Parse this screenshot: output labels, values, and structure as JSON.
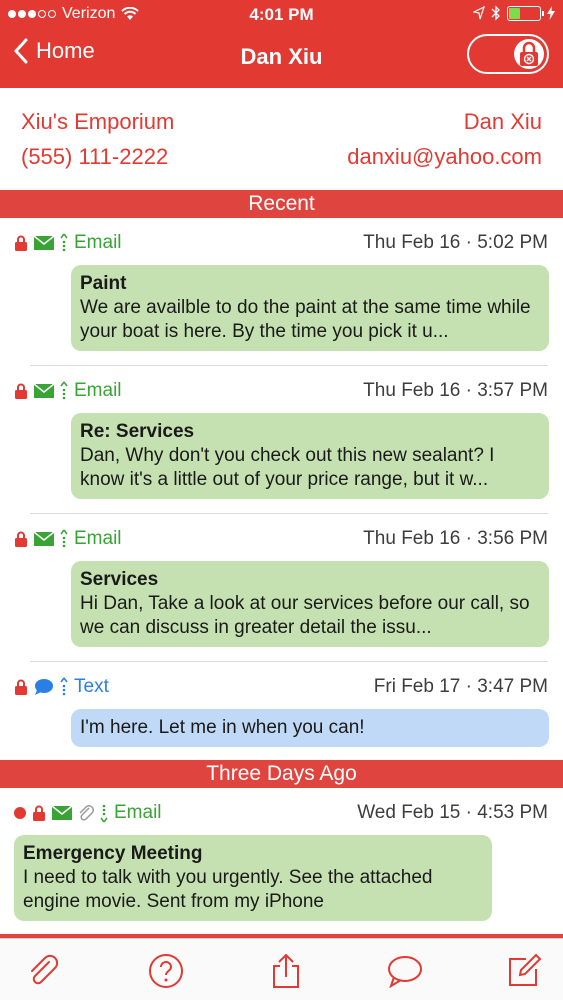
{
  "status": {
    "carrier": "Verizon",
    "time": "4:01 PM"
  },
  "nav": {
    "back_label": "Home",
    "title": "Dan Xiu"
  },
  "contact": {
    "company": "Xiu's Emporium",
    "phone": "(555) 111-2222",
    "name": "Dan Xiu",
    "email": "danxiu@yahoo.com"
  },
  "sections": {
    "recent": "Recent",
    "three_days": "Three Days Ago"
  },
  "messages": [
    {
      "type": "Email",
      "date": "Thu Feb 16 · 5:02 PM",
      "subject": "Paint",
      "body": "We are availble to do the paint at the same time while your boat is here. By the time you pick it u..."
    },
    {
      "type": "Email",
      "date": "Thu Feb 16 · 3:57 PM",
      "subject": "Re: Services",
      "body": "Dan, Why don't you check out this new sealant? I know it's a little out of your price range, but it w..."
    },
    {
      "type": "Email",
      "date": "Thu Feb 16 · 3:56 PM",
      "subject": "Services",
      "body": "Hi Dan, Take a look at our services before our call, so we can discuss in greater detail the issu..."
    },
    {
      "type": "Text",
      "date": "Fri Feb 17 · 3:47 PM",
      "body": "I'm here. Let me in when you can!"
    },
    {
      "type": "Email",
      "date": "Wed Feb 15 · 4:53 PM",
      "subject": "Emergency Meeting",
      "body": "I need to talk with you urgently. See the attached engine movie.  Sent from my iPhone"
    }
  ],
  "colors": {
    "brand_red": "#e23a33",
    "email_green": "#3aa335",
    "text_blue": "#2a7fe6",
    "email_bubble": "#c5e1b2",
    "text_bubble": "#bfd9f6"
  },
  "icons": [
    "lock-icon",
    "envelope-icon",
    "chat-bubble-icon",
    "paperclip-icon",
    "help-icon",
    "share-icon",
    "comment-icon",
    "compose-icon"
  ]
}
